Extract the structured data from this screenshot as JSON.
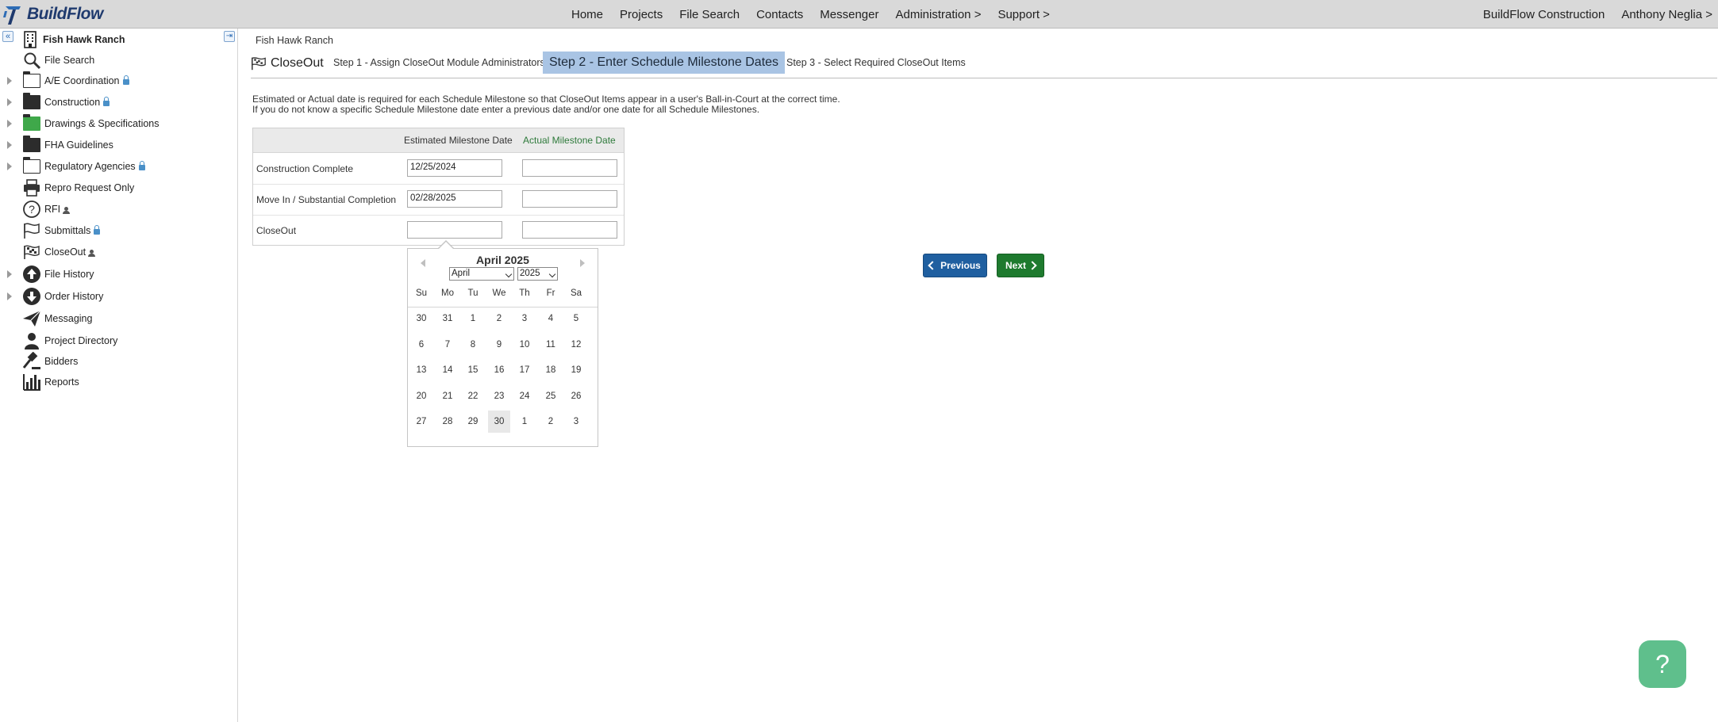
{
  "app": {
    "brand": "BuildFlow"
  },
  "topnav": {
    "items": [
      "Home",
      "Projects",
      "File Search",
      "Contacts",
      "Messenger",
      "Administration >",
      "Support >"
    ],
    "company": "BuildFlow Construction",
    "user": "Anthony Neglia >"
  },
  "sidebar": {
    "project": "Fish Hawk Ranch",
    "items": [
      {
        "label": "File Search",
        "icon": "search-icon"
      },
      {
        "label": "A/E Coordination",
        "icon": "folder-outline-icon",
        "locked": true
      },
      {
        "label": "Construction",
        "icon": "folder-icon",
        "locked": true
      },
      {
        "label": "Drawings & Specifications",
        "icon": "folder-green-icon"
      },
      {
        "label": "FHA Guidelines",
        "icon": "folder-icon"
      },
      {
        "label": "Regulatory Agencies",
        "icon": "folder-outline-icon",
        "locked": true
      },
      {
        "label": "Repro Request Only",
        "icon": "printer-icon"
      },
      {
        "label": "RFI",
        "icon": "question-icon"
      },
      {
        "label": "Submittals",
        "icon": "flag-icon",
        "locked": true
      },
      {
        "label": "CloseOut",
        "icon": "checkered-flag-icon"
      },
      {
        "label": "File History",
        "icon": "upload-circle-icon"
      },
      {
        "label": "Order History",
        "icon": "download-circle-icon"
      },
      {
        "label": "Messaging",
        "icon": "paper-plane-icon"
      },
      {
        "label": "Project Directory",
        "icon": "person-icon"
      },
      {
        "label": "Bidders",
        "icon": "gavel-icon"
      },
      {
        "label": "Reports",
        "icon": "bar-chart-icon"
      }
    ]
  },
  "main": {
    "breadcrumb": "Fish Hawk Ranch",
    "module_title": "CloseOut",
    "steps": [
      "Step 1 - Assign CloseOut Module Administrators",
      "Step 2 - Enter Schedule Milestone Dates",
      "Step 3 - Select Required CloseOut Items"
    ],
    "instructions": [
      "Estimated or Actual date is required for each Schedule Milestone so that CloseOut Items appear in a user's Ball-in-Court at the correct time.",
      "If you do not know a specific Schedule Milestone date enter a previous date and/or one date for all Schedule Milestones."
    ],
    "table": {
      "headers": [
        "Estimated Milestone Date",
        "Actual Milestone Date"
      ],
      "rows": [
        {
          "label": "Construction Complete",
          "estimated": "12/25/2024",
          "actual": ""
        },
        {
          "label": "Move In / Substantial Completion",
          "estimated": "02/28/2025",
          "actual": ""
        },
        {
          "label": "CloseOut",
          "estimated": "",
          "actual": ""
        }
      ]
    },
    "datepicker": {
      "title": "April 2025",
      "month": "April",
      "year": "2025",
      "dow": [
        "Su",
        "Mo",
        "Tu",
        "We",
        "Th",
        "Fr",
        "Sa"
      ],
      "weeks": [
        [
          "30",
          "31",
          "1",
          "2",
          "3",
          "4",
          "5"
        ],
        [
          "6",
          "7",
          "8",
          "9",
          "10",
          "11",
          "12"
        ],
        [
          "13",
          "14",
          "15",
          "16",
          "17",
          "18",
          "19"
        ],
        [
          "20",
          "21",
          "22",
          "23",
          "24",
          "25",
          "26"
        ],
        [
          "27",
          "28",
          "29",
          "30",
          "1",
          "2",
          "3"
        ]
      ],
      "highlighted": "30"
    },
    "buttons": {
      "previous": "Previous",
      "next": "Next"
    },
    "help": "?"
  },
  "colors": {
    "active_step_bg": "#a9c4e4",
    "previous_btn": "#1f5fa0",
    "next_btn": "#1e7a2e",
    "help_btn": "#5fbf8c",
    "actual_header": "#2e7a3b"
  }
}
